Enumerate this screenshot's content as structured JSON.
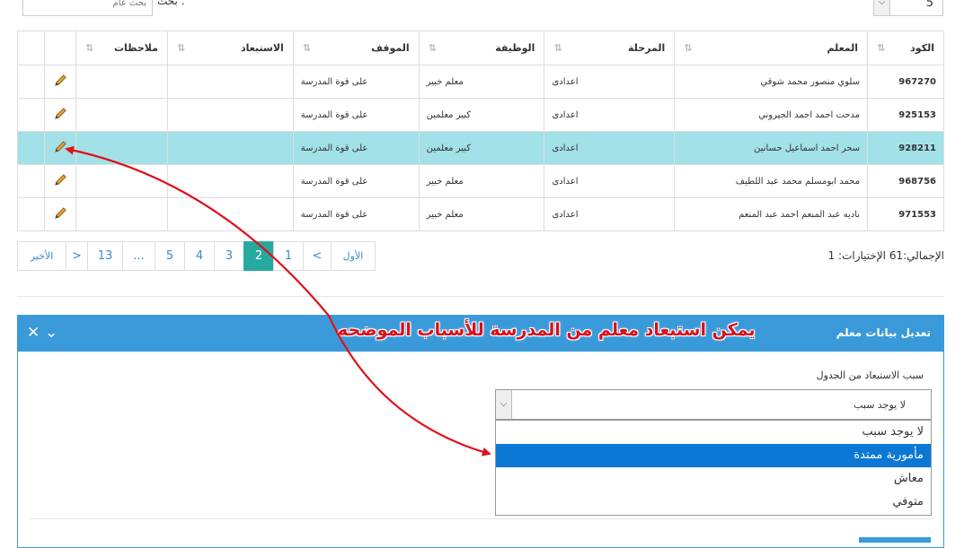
{
  "top": {
    "page_size": "5",
    "search_label": "بحث :",
    "search_placeholder": "بحث عام"
  },
  "table": {
    "headers": [
      "الكود",
      "المعلم",
      "المرحلة",
      "الوظيفة",
      "الموقف",
      "الاستبعاد",
      "ملاحظات"
    ],
    "rows": [
      {
        "code": "967270",
        "teacher": "سلوي منصور محمد شوقي",
        "stage": "اعدادى",
        "job": "معلم خبير",
        "position": "على قوة المدرسة",
        "exclusion": "",
        "notes": ""
      },
      {
        "code": "925153",
        "teacher": "مدحت احمد احمد الجيروني",
        "stage": "اعدادى",
        "job": "كبير معلمين",
        "position": "على قوة المدرسة",
        "exclusion": "",
        "notes": ""
      },
      {
        "code": "928211",
        "teacher": "سحر احمد اسماعيل حسانين",
        "stage": "اعدادى",
        "job": "كبير معلمين",
        "position": "على قوة المدرسة",
        "exclusion": "",
        "notes": ""
      },
      {
        "code": "968756",
        "teacher": "محمد ابومسلم محمد عبد اللطيف",
        "stage": "اعدادى",
        "job": "معلم خبير",
        "position": "على قوة المدرسة",
        "exclusion": "",
        "notes": ""
      },
      {
        "code": "971553",
        "teacher": "ناديه عبد المنعم احمد عبد المنعم",
        "stage": "اعدادى",
        "job": "معلم خبير",
        "position": "على قوة المدرسة",
        "exclusion": "",
        "notes": ""
      }
    ],
    "selected_row": 2
  },
  "pager": {
    "items": [
      "الأخير",
      ">",
      "13",
      "...",
      "5",
      "4",
      "3",
      "2",
      "1",
      "<",
      "الأول"
    ],
    "active": "2"
  },
  "total_text": "الإجمالي:61 الإختيارات: 1",
  "panel": {
    "title": "تعديل بيانات معلم",
    "annotation": "يمكن استبعاد معلم من المدرسة للأسباب الموضحه",
    "field_label": "سبب الاستبعاد من الجدول",
    "selected_value": "لا يوجد سبب",
    "options": [
      "لا يوجد سبب",
      "مأمورية ممتدة",
      "معاش",
      "متوفي"
    ],
    "highlighted_option": 1
  },
  "colors": {
    "panel_header": "#3a9ad9",
    "selected_row": "#a2e1e8",
    "active_page": "#27a9a0",
    "annotation": "#d8101c",
    "option_highlight": "#0a78d4"
  }
}
